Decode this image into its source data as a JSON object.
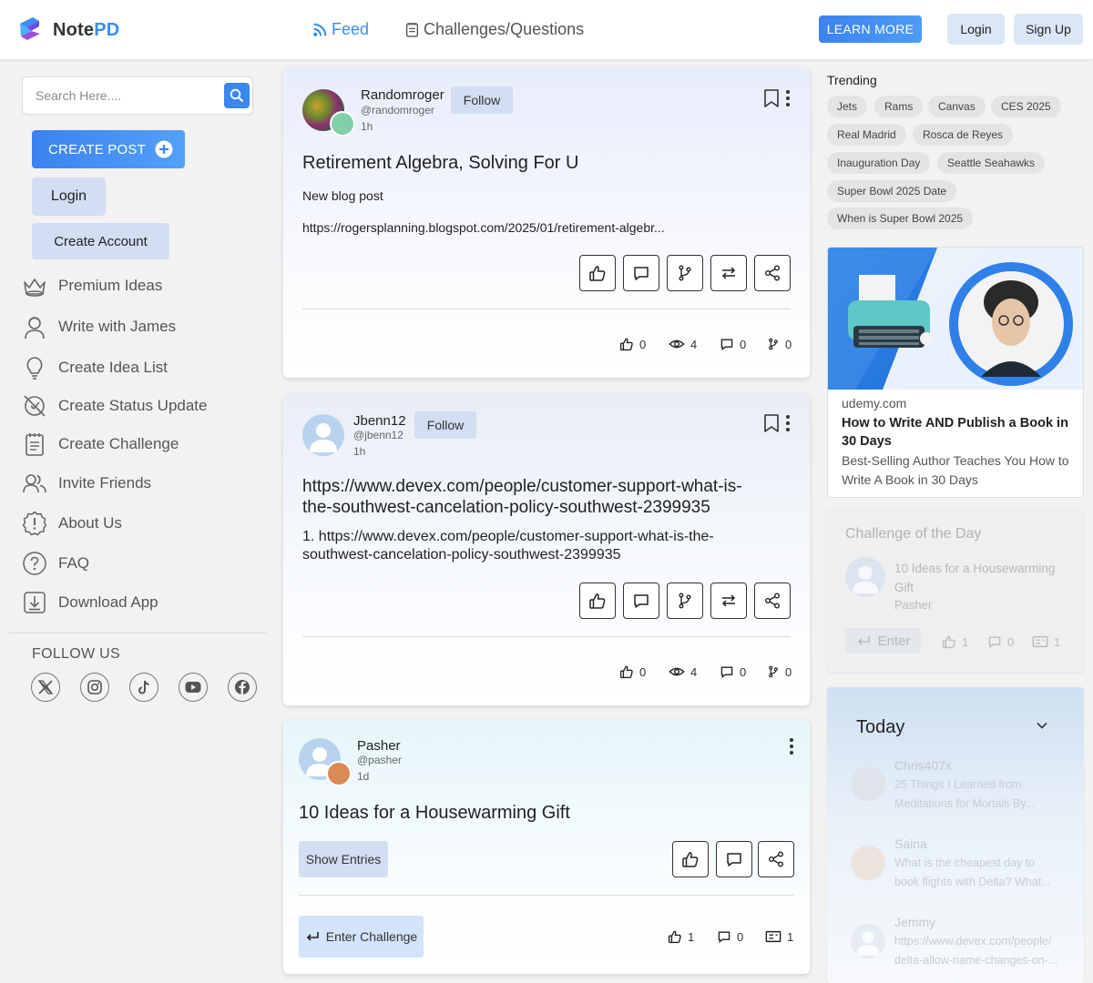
{
  "header": {
    "logo_note": "Note",
    "logo_pd": "PD",
    "nav_feed": "Feed",
    "nav_challenges": "Challenges/Questions",
    "learn_more": "LEARN MORE",
    "login": "Login",
    "sign_up": "Sign Up"
  },
  "sidebar": {
    "search_placeholder": "Search Here....",
    "create_post": "CREATE POST",
    "login": "Login",
    "create_account": "Create Account",
    "menu": [
      {
        "label": "Premium Ideas",
        "icon": "crown-icon"
      },
      {
        "label": "Write with James",
        "icon": "person-icon"
      },
      {
        "label": "Create Idea List",
        "icon": "lightbulb-icon"
      },
      {
        "label": "Create Status Update",
        "icon": "status-update-icon"
      },
      {
        "label": "Create Challenge",
        "icon": "notepad-icon"
      },
      {
        "label": "Invite Friends",
        "icon": "friends-icon"
      },
      {
        "label": "About Us",
        "icon": "info-alert-icon"
      },
      {
        "label": "FAQ",
        "icon": "question-icon"
      },
      {
        "label": "Download App",
        "icon": "download-icon"
      }
    ],
    "follow_us": "FOLLOW US",
    "socials": [
      "x-icon",
      "instagram-icon",
      "tiktok-icon",
      "youtube-icon",
      "facebook-icon"
    ]
  },
  "feed": {
    "posts": [
      {
        "username": "Randomroger",
        "handle": "@randomroger",
        "time": "1h",
        "follow": "Follow",
        "title": "Retirement Algebra, Solving For U",
        "body": "New blog post",
        "link": "https://rogersplanning.blogspot.com/2025/01/retirement-algebr...",
        "likes": "0",
        "views": "4",
        "comments": "0",
        "forks": "0"
      },
      {
        "username": "Jbenn12",
        "handle": "@jbenn12",
        "time": "1h",
        "follow": "Follow",
        "title_line1": "https://www.devex.com/people/customer-support-what-is-",
        "title_line2": "the-southwest-cancelation-policy-southwest-2399935",
        "body_line1": "1. https://www.devex.com/people/customer-support-what-is-the-",
        "body_line2": "southwest-cancelation-policy-southwest-2399935",
        "likes": "0",
        "views": "4",
        "comments": "0",
        "forks": "0"
      },
      {
        "username": "Pasher",
        "handle": "@pasher",
        "time": "1d",
        "title": "10 Ideas for a Housewarming Gift",
        "show_entries": "Show Entries",
        "enter_challenge": "Enter Challenge",
        "likes": "1",
        "comments": "0",
        "entries": "1"
      }
    ]
  },
  "right": {
    "trending_title": "Trending",
    "trending": [
      "Jets",
      "Rams",
      "Canvas",
      "CES 2025",
      "Real Madrid",
      "Rosca de Reyes",
      "Inauguration Day",
      "Seattle Seahawks",
      "Super Bowl 2025 Date",
      "When is Super Bowl 2025"
    ],
    "ad": {
      "domain": "udemy.com",
      "title": "How to Write AND Publish a Book in 30 Days",
      "description": "Best-Selling Author Teaches You How to Write A Book in 30 Days"
    },
    "challenge_of_day": {
      "title": "Challenge of the Day",
      "name": "10 Ideas for a Housewarming Gift",
      "author": "Pasher",
      "enter": "Enter",
      "likes": "1",
      "comments": "0",
      "entries": "1"
    },
    "today": {
      "title": "Today",
      "items": [
        {
          "name": "Chris407x",
          "snippet_line1": "25 Things I Learned from",
          "snippet_line2": "Meditations for Mortals By..."
        },
        {
          "name": "Saina",
          "snippet_line1": "What is the cheapest day to",
          "snippet_line2": "book flights with Delta? What..."
        },
        {
          "name": "Jemmy",
          "snippet_line1": "https://www.devex.com/people/",
          "snippet_line2": "delta-allow-name-changes-on-..."
        }
      ]
    }
  },
  "colors": {
    "accent": "#3b8cf2",
    "soft_button": "#d3def3",
    "chip_bg": "#e4e4e4"
  }
}
